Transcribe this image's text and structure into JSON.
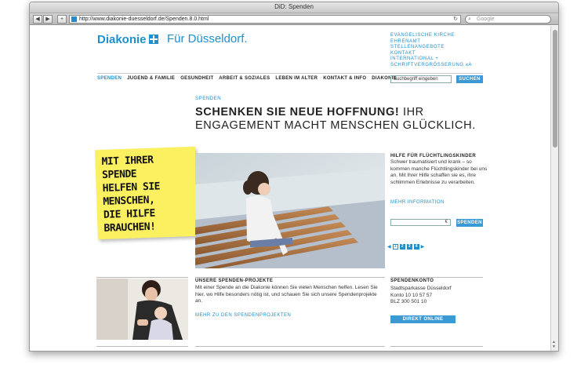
{
  "browser": {
    "window_title": "DiD: Spenden",
    "url": "http://www.diakonie-duesseldorf.de/Spenden.8.0.html",
    "search_placeholder": "Google"
  },
  "header": {
    "logo_text": "Diakonie",
    "tagline": "Für Düsseldorf.",
    "top_links": [
      "EVANGELISCHE KIRCHE",
      "EHRENAMT",
      "STELLENANGEBOTE",
      "KONTAKT",
      "INTERNATIONAL +",
      "SCHRIFTVERGRÖSSERUNG ᴀA"
    ]
  },
  "nav": {
    "items": [
      "SPENDEN",
      "JUGEND & FAMILIE",
      "GESUNDHEIT",
      "ARBEIT & SOZIALES",
      "LEBEN IM ALTER",
      "KONTAKT & INFO",
      "DIAKONIE"
    ],
    "search_value": "Suchbegriff eingeben",
    "search_button": "SUCHEN"
  },
  "main": {
    "breadcrumb": "SPENDEN",
    "headline_bold": "SCHENKEN SIE NEUE HOFFNUNG!",
    "headline_rest_1": " IHR",
    "headline_line2": "ENGAGEMENT MACHT MENSCHEN GLÜCKLICH.",
    "note_text": "MIT IHRER\nSPENDE\nHELFEN SIE\nMENSCHEN,\nDIE HILFE\nBRAUCHEN!"
  },
  "feature": {
    "heading": "HILFE FÜR FLÜCHTLINGSKINDER",
    "text": "Schwer traumatisiert und krank – so kommen manche Flüchtlingskinder bei uns an. Mit Ihrer Hilfe schaffen sie es, ihre schlimmen Erlebnisse zu verarbeiten.",
    "more": "MEHR INFORMATION",
    "amount_currency": "€",
    "donate_button": "SPENDEN",
    "pager": [
      "1",
      "2",
      "3",
      "4"
    ]
  },
  "projects": {
    "heading": "UNSERE SPENDEN-PROJEKTE",
    "text": "Mit einer Spende an die Diakonie können Sie vielen Menschen helfen. Lesen Sie hier, wo Hilfe besonders nötig ist, und schauen Sie sich unsere Spendenprojekte an.",
    "more": "MEHR ZU DEN SPENDENPROJEKTEN"
  },
  "account": {
    "heading": "SPENDENKONTO",
    "bank": "Stadtsparkasse Düsseldorf",
    "konto": "Konto 10 10 57 57",
    "blz": "BLZ 300 501 10",
    "button": "DIREKT ONLINE SPENDEN"
  },
  "colors": {
    "brand_blue": "#1f8fcd",
    "note_yellow": "#fbf160",
    "button_blue": "#3b9ad6"
  }
}
